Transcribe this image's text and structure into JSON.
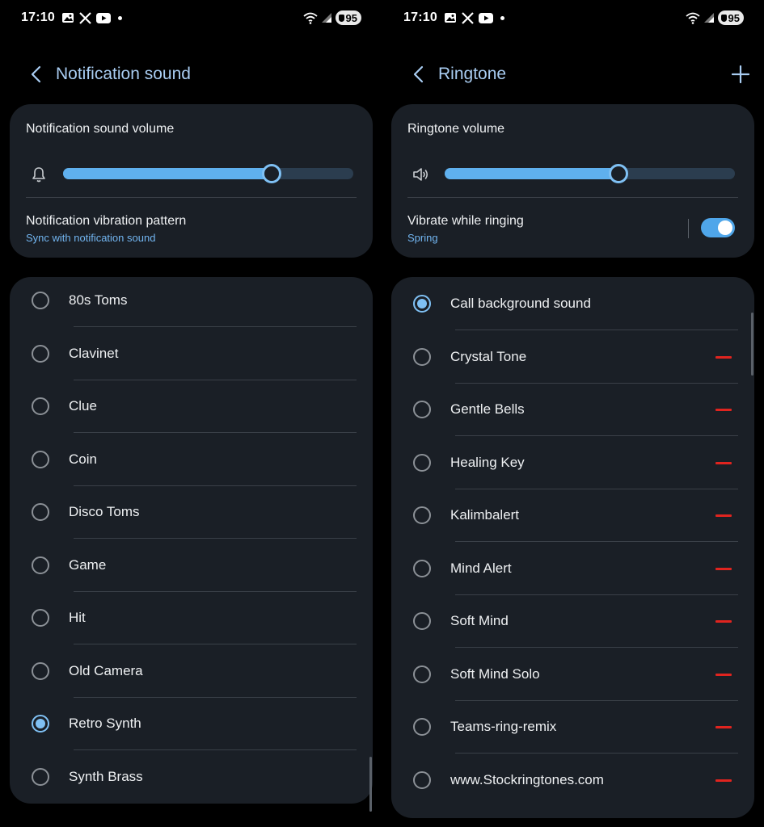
{
  "colors": {
    "accent": "#7fc0f3",
    "slider_fill": "#5fb0ee",
    "card_bg": "#1a1f26",
    "delete": "#e0241f",
    "title": "#a9cdf2"
  },
  "left": {
    "status_bar": {
      "time": "17:10",
      "battery": "95",
      "icons": [
        "gallery-icon",
        "x-icon",
        "youtube-icon",
        "wifi-icon",
        "signal-icon"
      ]
    },
    "header": {
      "title": "Notification sound"
    },
    "volume": {
      "label": "Notification sound volume",
      "icon": "bell-icon",
      "level": 0.72
    },
    "vibration": {
      "title": "Notification vibration pattern",
      "subtitle": "Sync with notification sound"
    },
    "sounds": [
      {
        "label": "80s Toms",
        "selected": false
      },
      {
        "label": "Clavinet",
        "selected": false
      },
      {
        "label": "Clue",
        "selected": false
      },
      {
        "label": "Coin",
        "selected": false
      },
      {
        "label": "Disco Toms",
        "selected": false
      },
      {
        "label": "Game",
        "selected": false
      },
      {
        "label": "Hit",
        "selected": false
      },
      {
        "label": "Old Camera",
        "selected": false
      },
      {
        "label": "Retro Synth",
        "selected": true
      },
      {
        "label": "Synth Brass",
        "selected": false
      }
    ]
  },
  "right": {
    "status_bar": {
      "time": "17:10",
      "battery": "95",
      "icons": [
        "gallery-icon",
        "x-icon",
        "youtube-icon",
        "wifi-icon",
        "signal-icon"
      ]
    },
    "header": {
      "title": "Ringtone",
      "add_icon": "plus-icon"
    },
    "volume": {
      "label": "Ringtone volume",
      "icon": "speaker-icon",
      "level": 0.6
    },
    "vibration": {
      "title": "Vibrate while ringing",
      "subtitle": "Spring",
      "toggle_on": true
    },
    "ringtones": [
      {
        "label": "Call background sound",
        "selected": true,
        "deletable": false
      },
      {
        "label": "Crystal Tone",
        "selected": false,
        "deletable": true
      },
      {
        "label": "Gentle Bells",
        "selected": false,
        "deletable": true
      },
      {
        "label": "Healing Key",
        "selected": false,
        "deletable": true
      },
      {
        "label": "Kalimbalert",
        "selected": false,
        "deletable": true
      },
      {
        "label": "Mind Alert",
        "selected": false,
        "deletable": true
      },
      {
        "label": "Soft Mind",
        "selected": false,
        "deletable": true
      },
      {
        "label": "Soft Mind Solo",
        "selected": false,
        "deletable": true
      },
      {
        "label": "Teams-ring-remix",
        "selected": false,
        "deletable": true
      },
      {
        "label": "www.Stockringtones.com",
        "selected": false,
        "deletable": true
      }
    ]
  }
}
